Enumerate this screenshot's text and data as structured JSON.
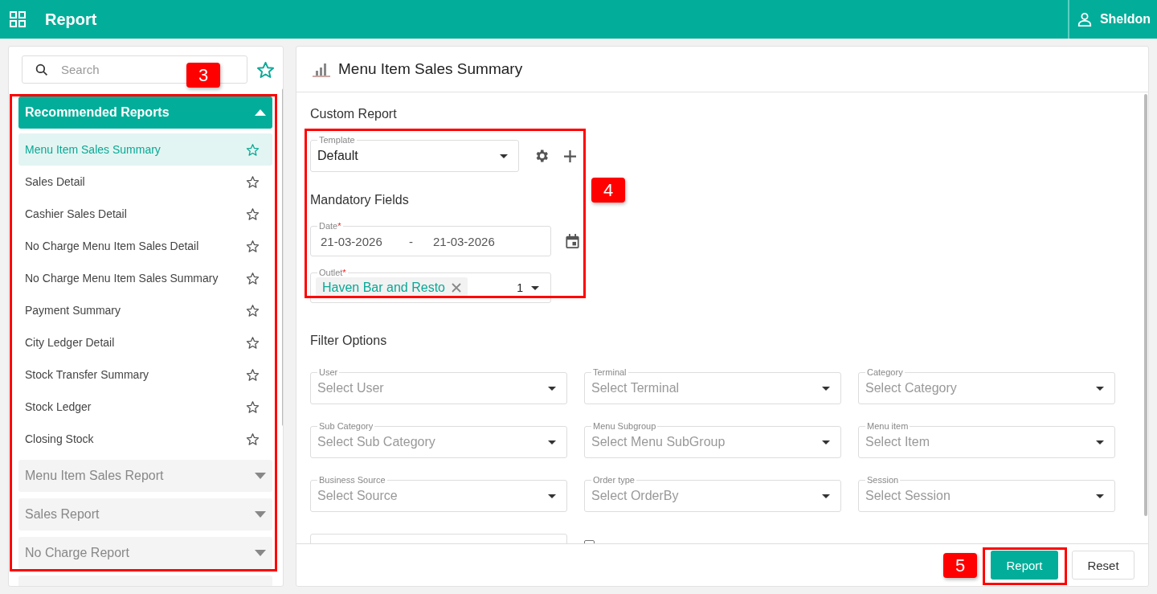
{
  "app_bar": {
    "title": "Report",
    "user": "Sheldon"
  },
  "sidebar": {
    "search": {
      "placeholder": "Search"
    },
    "groups": [
      {
        "title": "Recommended Reports",
        "expanded": true,
        "items": [
          {
            "label": "Menu Item Sales Summary",
            "selected": true
          },
          {
            "label": "Sales Detail",
            "selected": false
          },
          {
            "label": "Cashier Sales Detail",
            "selected": false
          },
          {
            "label": "No Charge Menu Item Sales Detail",
            "selected": false
          },
          {
            "label": "No Charge Menu Item Sales Summary",
            "selected": false
          },
          {
            "label": "Payment Summary",
            "selected": false
          },
          {
            "label": "City Ledger Detail",
            "selected": false
          },
          {
            "label": "Stock Transfer Summary",
            "selected": false
          },
          {
            "label": "Stock Ledger",
            "selected": false
          },
          {
            "label": "Closing Stock",
            "selected": false
          }
        ]
      },
      {
        "title": "Menu Item Sales Report",
        "expanded": false
      },
      {
        "title": "Sales Report",
        "expanded": false
      },
      {
        "title": "No Charge Report",
        "expanded": false
      },
      {
        "expanded": false
      }
    ]
  },
  "report": {
    "title": "Menu Item Sales Summary",
    "custom_report": {
      "heading": "Custom Report",
      "template": {
        "label": "Template",
        "value": "Default"
      }
    },
    "mandatory": {
      "heading": "Mandatory Fields",
      "date": {
        "label": "Date",
        "required_mark": "*",
        "from": "21-03-2026",
        "separator": "-",
        "to": "21-03-2026"
      },
      "outlet": {
        "label": "Outlet",
        "required_mark": "*",
        "chips": [
          {
            "text": "Haven Bar and Resto"
          }
        ],
        "count": "1"
      }
    },
    "filters": {
      "heading": "Filter Options",
      "fields": [
        {
          "label": "User",
          "placeholder": "Select User"
        },
        {
          "label": "Terminal",
          "placeholder": "Select Terminal"
        },
        {
          "label": "Category",
          "placeholder": "Select Category"
        },
        {
          "label": "Sub Category",
          "placeholder": "Select Sub Category"
        },
        {
          "label": "Menu Subgroup",
          "placeholder": "Select Menu SubGroup"
        },
        {
          "label": "Menu item",
          "placeholder": "Select Item"
        },
        {
          "label": "Business Source",
          "placeholder": "Select Source"
        },
        {
          "label": "Order type",
          "placeholder": "Select OrderBy"
        },
        {
          "label": "Session",
          "placeholder": "Select Session"
        }
      ],
      "checkbox": {
        "checked": false
      }
    },
    "buttons": [
      {
        "label": "Report",
        "kind": "primary"
      },
      {
        "label": "Reset",
        "kind": "secondary"
      }
    ]
  },
  "annotations": [
    {
      "label": "3"
    },
    {
      "label": "4"
    },
    {
      "label": "5"
    }
  ]
}
